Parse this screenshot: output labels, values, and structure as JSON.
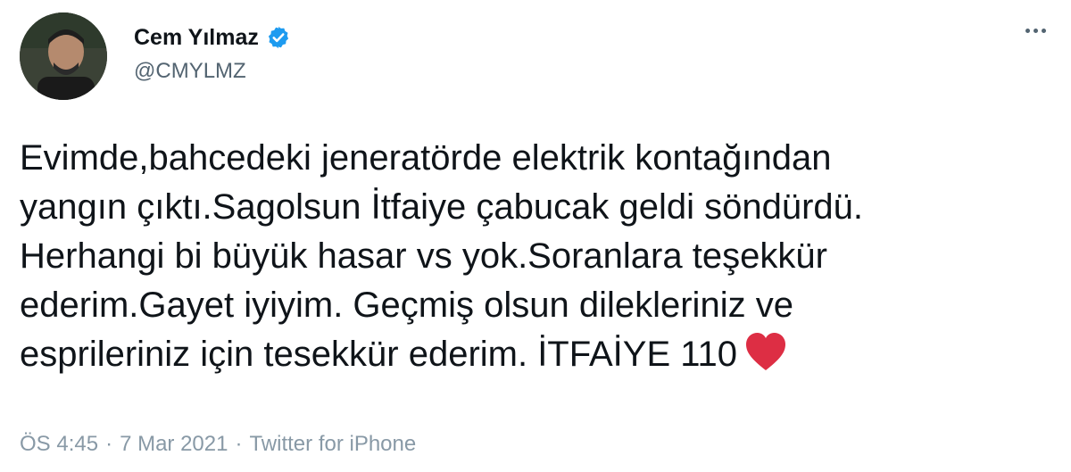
{
  "author": {
    "display_name": "Cem Yılmaz",
    "handle": "@CMYLMZ",
    "verified": true,
    "verified_icon": "verified-badge-icon",
    "avatar_icon": "profile-photo"
  },
  "more_icon": "more-options-icon",
  "tweet": {
    "lines": [
      "Evimde,bahcedeki jeneratörde elektrik kontağından",
      "yangın çıktı.Sagolsun İtfaiye çabucak geldi söndürdü.",
      "Herhangi bi büyük hasar vs yok.Soranlara teşekkür",
      "ederim.Gayet iyiyim. Geçmiş olsun dilekleriniz ve",
      "esprileriniz için tesekkür ederim. İTFAİYE 110"
    ],
    "emoji": "red-heart-icon"
  },
  "meta": {
    "time": "ÖS 4:45",
    "separator": "·",
    "date": "7 Mar 2021",
    "source": "Twitter for iPhone"
  },
  "colors": {
    "text": "#0f1419",
    "secondary": "#536471",
    "meta": "#8899a6",
    "verified": "#1d9bf0",
    "heart": "#dd2e44"
  }
}
